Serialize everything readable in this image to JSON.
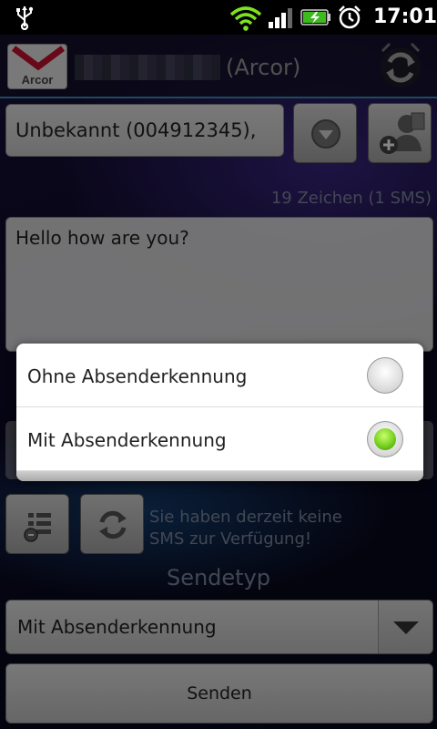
{
  "status_bar": {
    "time": "17:01",
    "icons": [
      "usb-icon",
      "wifi-icon",
      "signal-icon",
      "battery-charging-icon",
      "alarm-icon"
    ]
  },
  "header": {
    "logo_text": "Arcor",
    "title": "(Arcor)"
  },
  "recipient": {
    "value": "Unbekannt (004912345),"
  },
  "char_count": "19 Zeichen (1 SMS)",
  "message": {
    "value": "Hello how are you?"
  },
  "info": {
    "line1": "Sie haben derzeit keine",
    "line2": "SMS zur Verfügung!"
  },
  "send_type": {
    "label": "Sendetyp",
    "selected": "Mit Absenderkennung"
  },
  "send_button": {
    "label": "Senden"
  },
  "dialog": {
    "options": [
      {
        "label": "Ohne Absenderkennung",
        "checked": false
      },
      {
        "label": "Mit Absenderkennung",
        "checked": true
      }
    ]
  },
  "colors": {
    "accent_line": "#3a8fb8",
    "radio_selected": "#6fcb1a"
  }
}
